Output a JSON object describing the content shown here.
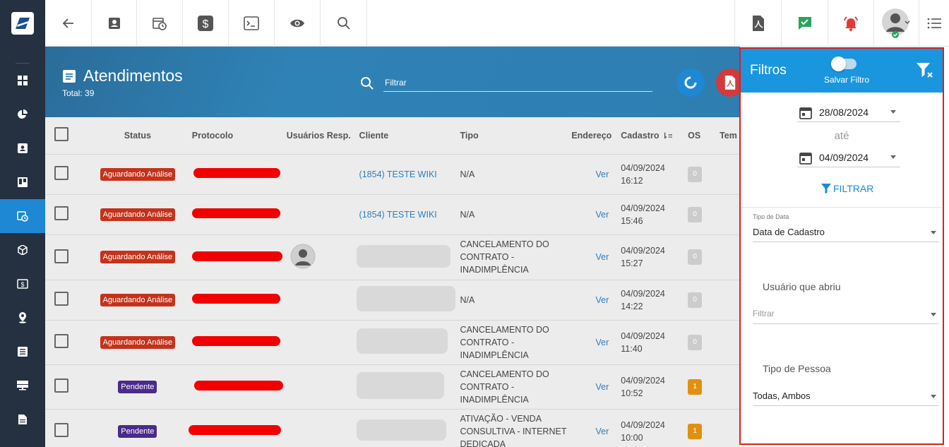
{
  "colors": {
    "sidebar": "#253040",
    "accent": "#1a96de",
    "badge_analise": "#c5321b",
    "badge_pendente": "#4a2a8a",
    "os_orange": "#e09010",
    "redact": "#f20000",
    "panel_border": "#e11d1d"
  },
  "sidebar": {
    "items": [
      "grid-icon",
      "pie-chart-icon",
      "contact-card-icon",
      "board-icon",
      "calendar-clock-icon",
      "cube-icon",
      "money-icon",
      "location-icon",
      "list-icon",
      "server-icon",
      "document-icon"
    ],
    "active_index": 4
  },
  "topbar": {
    "icons": [
      "back-arrow-icon",
      "contact-card-icon",
      "calendar-clock-icon",
      "dollar-icon",
      "terminal-icon",
      "eye-icon",
      "search-icon"
    ],
    "right_icons": [
      "pdf-icon",
      "chat-check-icon",
      "alarm-bell-icon",
      "user-avatar-icon",
      "menu-list-icon"
    ]
  },
  "header": {
    "title": "Atendimentos",
    "total": "Total: 39",
    "search_placeholder": "Filtrar"
  },
  "table": {
    "columns": {
      "status": "Status",
      "protocolo": "Protocolo",
      "usuarios": "Usuários Resp.",
      "cliente": "Cliente",
      "tipo": "Tipo",
      "endereco": "Endereço",
      "cadastro": "Cadastro",
      "os": "OS",
      "tem": "Tem"
    },
    "rows": [
      {
        "status": "Aguardando Análise",
        "cliente": "(1854) TESTE WIKI",
        "tipo": [
          "N/A"
        ],
        "endereco": "Ver",
        "data": "04/09/2024",
        "hora": "16:12",
        "os": "0"
      },
      {
        "status": "Aguardando Análise",
        "cliente": "(1854) TESTE WIKI",
        "tipo": [
          "N/A"
        ],
        "endereco": "Ver",
        "data": "04/09/2024",
        "hora": "15:46",
        "os": "0"
      },
      {
        "status": "Aguardando Análise",
        "cliente": "",
        "tipo": [
          "CANCELAMENTO DO",
          "CONTRATO -",
          "INADIMPLÊNCIA"
        ],
        "endereco": "Ver",
        "data": "04/09/2024",
        "hora": "15:27",
        "os": "0"
      },
      {
        "status": "Aguardando Análise",
        "cliente": "",
        "tipo": [
          "N/A"
        ],
        "endereco": "Ver",
        "data": "04/09/2024",
        "hora": "14:22",
        "os": "0"
      },
      {
        "status": "Aguardando Análise",
        "cliente": "",
        "tipo": [
          "CANCELAMENTO DO",
          "CONTRATO -",
          "INADIMPLÊNCIA"
        ],
        "endereco": "Ver",
        "data": "04/09/2024",
        "hora": "11:40",
        "os": "0"
      },
      {
        "status": "Pendente",
        "cliente": "",
        "tipo": [
          "CANCELAMENTO DO",
          "CONTRATO -",
          "INADIMPLÊNCIA"
        ],
        "endereco": "Ver",
        "data": "04/09/2024",
        "hora": "10:52",
        "os": "1"
      },
      {
        "status": "Pendente",
        "cliente": "",
        "tipo": [
          "ATIVAÇÃO - VENDA",
          "CONSULTIVA - INTERNET",
          "DEDICADA"
        ],
        "endereco": "Ver",
        "data": "04/09/2024",
        "hora": "10:00",
        "os": "1"
      }
    ]
  },
  "filters": {
    "title": "Filtros",
    "save_filter": "Salvar Filtro",
    "date_from": "28/08/2024",
    "until": "até",
    "date_to": "04/09/2024",
    "apply": "FILTRAR",
    "date_type_label": "Tipo de Data",
    "date_type_value": "Data de Cadastro",
    "opened_by_label": "Usuário que abriu",
    "opened_by_placeholder": "Filtrar",
    "person_type_label": "Tipo de Pessoa",
    "person_type_value": "Todas, Ambos"
  }
}
